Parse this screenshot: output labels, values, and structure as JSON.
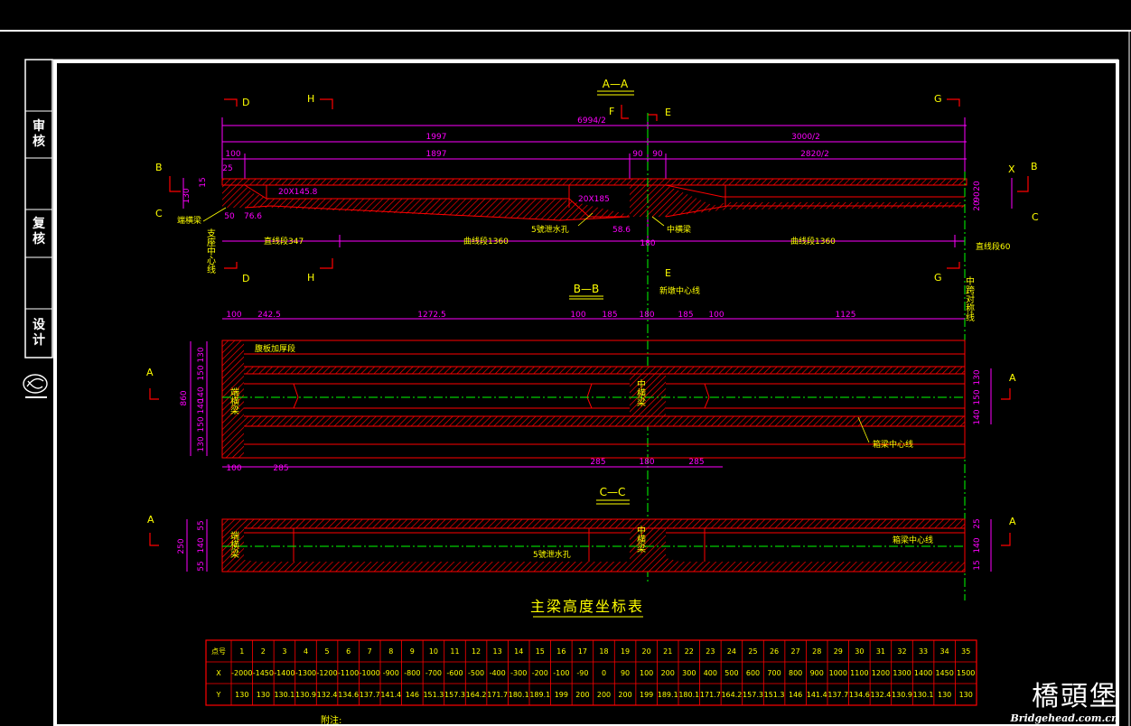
{
  "side_block": {
    "review": "审核",
    "recheck": "复核",
    "design": "设计"
  },
  "sections": {
    "aa": {
      "title": "A—A",
      "cut_d": "D",
      "cut_h": "H",
      "cut_f": "F",
      "cut_e": "E",
      "cut_g": "G",
      "cut_b": "B",
      "cut_c": "C",
      "cut_x": "X",
      "dim_total": "6994/2",
      "dim_left": "1997",
      "dim_right": "3000/2",
      "dim_100": "100",
      "dim_1897": "1897",
      "dim_90a": "90",
      "dim_90b": "90",
      "dim_2820": "2820/2",
      "dim_25": "25",
      "dim_130": "130",
      "dim_15": "15",
      "dim_r1": "20",
      "dim_r2": "90",
      "dim_r3": "20",
      "dim_50": "50",
      "dim_76": "76.6",
      "dim_58": "58.6",
      "dim_180": "180",
      "lbl_endbeam": "端横梁",
      "lbl_support": "支座中心线",
      "lbl_drain": "5號泄水孔",
      "lbl_midbeam": "中横梁",
      "lbl_hole1": "20X145.8",
      "lbl_hole2": "20X185",
      "seg_straight1": "直线段347",
      "seg_curve1": "曲线段1360",
      "seg_curve2": "曲线段1360",
      "seg_straight2": "直线段60"
    },
    "bb": {
      "title": "B—B",
      "lbl_newcenter": "新墩中心线",
      "lbl_symm": "中跨对称线",
      "dims_top": [
        "100",
        "242.5",
        "1272.5",
        "100",
        "185",
        "180",
        "185",
        "100",
        "1125"
      ],
      "dim_860": "860",
      "dims_left": [
        "130",
        "150",
        "140",
        "140",
        "150",
        "130"
      ],
      "dims_right": [
        "130",
        "150",
        "140"
      ],
      "dims_bottom": [
        "100",
        "285",
        "285",
        "180",
        "285"
      ],
      "cut_a1": "A",
      "cut_a2": "A",
      "lbl_web": "腹板加厚段",
      "lbl_endbeam": "端横梁",
      "lbl_midbeam": "中横梁",
      "lbl_girder": "箱梁中心线"
    },
    "cc": {
      "title": "C—C",
      "cut_a1": "A",
      "cut_a2": "A",
      "dim_250": "250",
      "dims_left": [
        "55",
        "140",
        "55"
      ],
      "dims_right": [
        "25",
        "140",
        "15"
      ],
      "lbl_endbeam": "端横梁",
      "lbl_midbeam": "中横梁",
      "lbl_drain": "5號泄水孔",
      "lbl_girder": "箱梁中心线"
    }
  },
  "table": {
    "title": "主梁高度坐标表",
    "row_labels": [
      "点号",
      "X",
      "Y"
    ],
    "points": [
      "1",
      "2",
      "3",
      "4",
      "5",
      "6",
      "7",
      "8",
      "9",
      "10",
      "11",
      "12",
      "13",
      "14",
      "15",
      "16",
      "17",
      "18",
      "19",
      "20",
      "21",
      "22",
      "23",
      "24",
      "25",
      "26",
      "27",
      "28",
      "29",
      "30",
      "31",
      "32",
      "33",
      "34",
      "35"
    ],
    "x": [
      "-2000",
      "-1450",
      "-1400",
      "-1300",
      "-1200",
      "-1100",
      "-1000",
      "-900",
      "-800",
      "-700",
      "-600",
      "-500",
      "-400",
      "-300",
      "-200",
      "-100",
      "-90",
      "0",
      "90",
      "100",
      "200",
      "300",
      "400",
      "500",
      "600",
      "700",
      "800",
      "900",
      "1000",
      "1100",
      "1200",
      "1300",
      "1400",
      "1450",
      "1500"
    ],
    "y": [
      "130",
      "130",
      "130.1",
      "130.9",
      "132.4",
      "134.6",
      "137.7",
      "141.4",
      "146",
      "151.3",
      "157.3",
      "164.2",
      "171.7",
      "180.1",
      "189.1",
      "199",
      "200",
      "200",
      "200",
      "199",
      "189.1",
      "180.1",
      "171.7",
      "164.2",
      "157.3",
      "151.3",
      "146",
      "141.4",
      "137.7",
      "134.6",
      "132.4",
      "130.9",
      "130.1",
      "130",
      "130"
    ]
  },
  "notes_label": "附注:",
  "watermark": {
    "cn": "橋頭堡",
    "en": "Bridgehead.com.cn"
  },
  "colors": {
    "frame": "#ffffff",
    "dim": "#ff00ff",
    "text": "#ffff00",
    "section": "#ff0000",
    "center": "#00ff00"
  }
}
